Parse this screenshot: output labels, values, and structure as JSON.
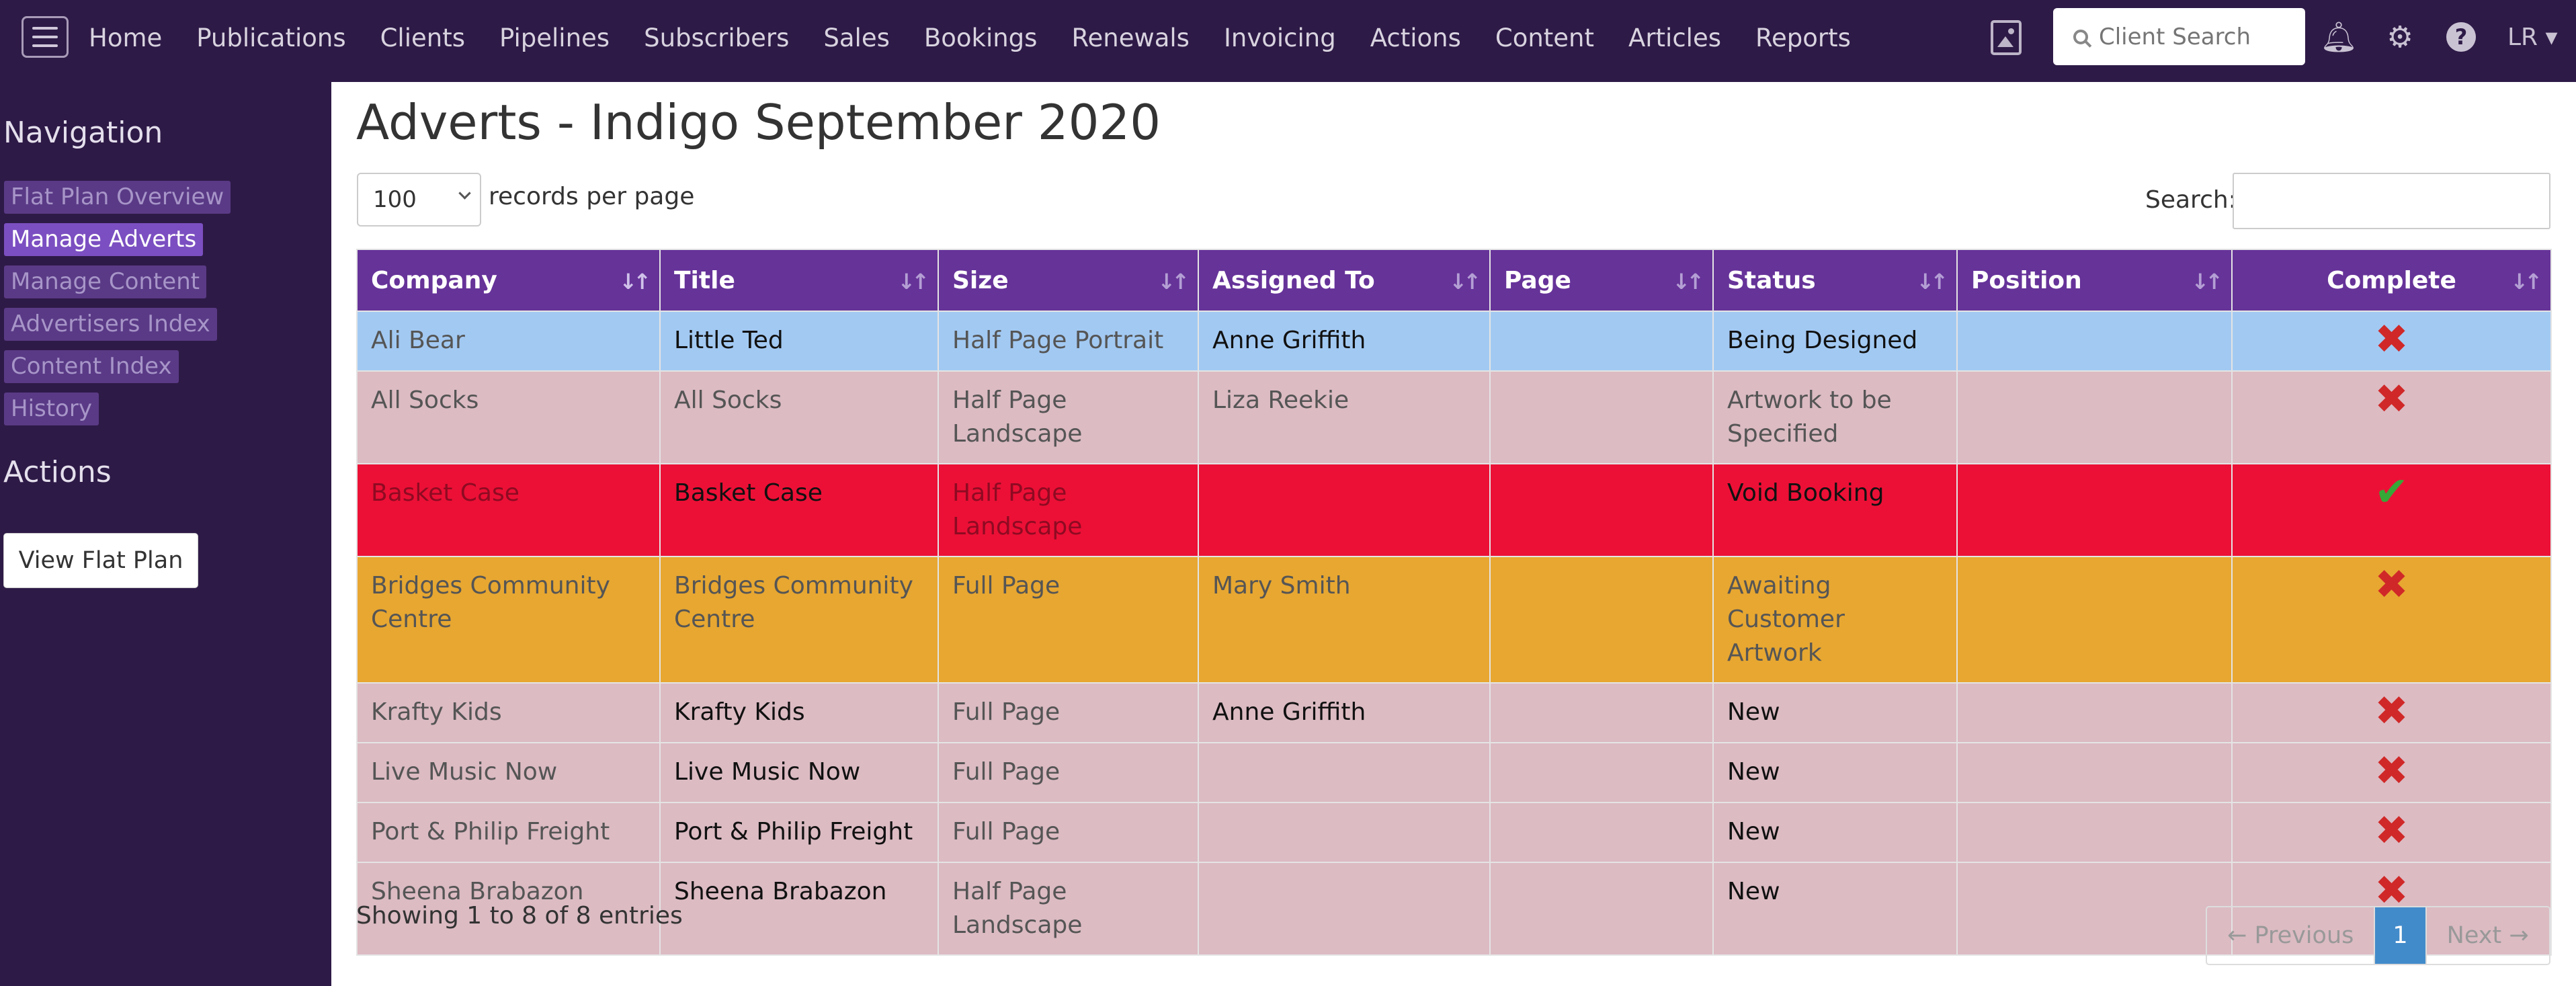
{
  "nav": {
    "items": [
      "Home",
      "Publications",
      "Clients",
      "Pipelines",
      "Subscribers",
      "Sales",
      "Bookings",
      "Renewals",
      "Invoicing",
      "Actions",
      "Content",
      "Articles",
      "Reports"
    ],
    "client_search_placeholder": "Client Search",
    "user": "LR ▾"
  },
  "sidebar": {
    "navigation_heading": "Navigation",
    "items": [
      "Flat Plan Overview",
      "Manage Adverts",
      "Manage Content",
      "Advertisers Index",
      "Content Index",
      "History"
    ],
    "actions_heading": "Actions",
    "view_flat_plan": "View Flat Plan"
  },
  "main": {
    "title": "Adverts - Indigo September 2020",
    "length_value": "100",
    "length_label": "records per page",
    "search_label": "Search:",
    "columns": [
      "Company",
      "Title",
      "Size",
      "Assigned To",
      "Page",
      "Status",
      "Position",
      "Complete"
    ],
    "rows": [
      {
        "company": "Ali Bear",
        "title": "Little Ted",
        "size": "Half Page Portrait",
        "assigned": "Anne Griffith",
        "page": "",
        "status": "Being Designed",
        "position": "",
        "complete": "✖"
      },
      {
        "company": "All Socks",
        "title": "All Socks",
        "size": "Half Page Landscape",
        "assigned": "Liza Reekie",
        "page": "",
        "status": "Artwork to be Specified",
        "position": "",
        "complete": "✖"
      },
      {
        "company": "Basket Case",
        "title": "Basket Case",
        "size": "Half Page Landscape",
        "assigned": "",
        "page": "",
        "status": "Void Booking",
        "position": "",
        "complete": "✔"
      },
      {
        "company": "Bridges Community Centre",
        "title": "Bridges Community Centre",
        "size": "Full Page",
        "assigned": "Mary Smith",
        "page": "",
        "status": "Awaiting Customer Artwork",
        "position": "",
        "complete": "✖"
      },
      {
        "company": "Krafty Kids",
        "title": "Krafty Kids",
        "size": "Full Page",
        "assigned": "Anne Griffith",
        "page": "",
        "status": "New",
        "position": "",
        "complete": "✖"
      },
      {
        "company": "Live Music Now",
        "title": "Live Music Now",
        "size": "Full Page",
        "assigned": "",
        "page": "",
        "status": "New",
        "position": "",
        "complete": "✖"
      },
      {
        "company": "Port & Philip Freight",
        "title": "Port & Philip Freight",
        "size": "Full Page",
        "assigned": "",
        "page": "",
        "status": "New",
        "position": "",
        "complete": "✖"
      },
      {
        "company": "Sheena Brabazon",
        "title": "Sheena Brabazon",
        "size": "Half Page Landscape",
        "assigned": "",
        "page": "",
        "status": "New",
        "position": "",
        "complete": "✖"
      }
    ],
    "info": "Showing 1 to 8 of 8 entries",
    "pager": {
      "prev": "← Previous",
      "current": "1",
      "next": "Next →"
    }
  },
  "colors": {
    "topbar": "#2e1a47",
    "header": "#663399",
    "row_blue": "#a2c9f2",
    "row_pink": "#dcbbc3",
    "row_red": "#ec1036",
    "row_orange": "#e7a731",
    "pager_active": "#428bca"
  },
  "icons": [
    "hamburger-icon",
    "image-icon",
    "search-icon",
    "bell-icon",
    "gear-icon",
    "help-icon",
    "sort-icon",
    "cross-icon",
    "check-icon"
  ]
}
